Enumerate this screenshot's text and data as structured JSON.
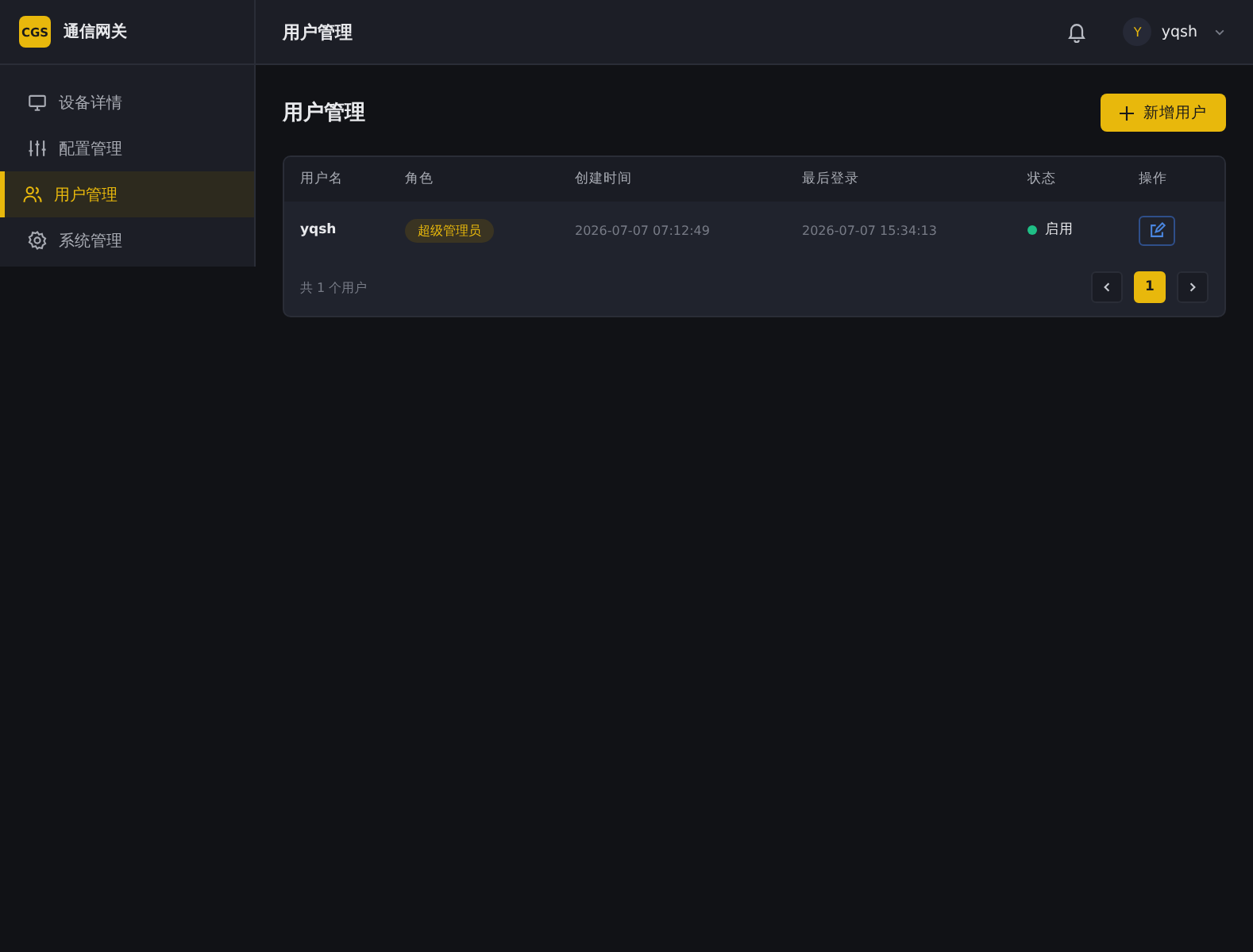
{
  "brand": {
    "logo": "CGS",
    "name": "通信网关"
  },
  "sidebar": {
    "items": [
      {
        "label": "设备详情",
        "selected": false
      },
      {
        "label": "配置管理",
        "selected": false
      },
      {
        "label": "用户管理",
        "selected": true
      },
      {
        "label": "系统管理",
        "selected": false
      }
    ]
  },
  "topbar": {
    "title": "用户管理",
    "user": {
      "initial": "Y",
      "name": "yqsh"
    }
  },
  "page": {
    "title": "用户管理",
    "add_button": "新增用户"
  },
  "table": {
    "columns": [
      "用户名",
      "角色",
      "创建时间",
      "最后登录",
      "状态",
      "操作"
    ],
    "rows": [
      {
        "username": "yqsh",
        "role": "超级管理员",
        "created": "2026-07-07 07:12:49",
        "last_login": "2026-07-07 15:34:13",
        "status": "启用",
        "enabled": true
      }
    ]
  },
  "footer": {
    "count": "共 1 个用户",
    "pages": [
      {
        "label": "1",
        "selected": true
      }
    ]
  }
}
